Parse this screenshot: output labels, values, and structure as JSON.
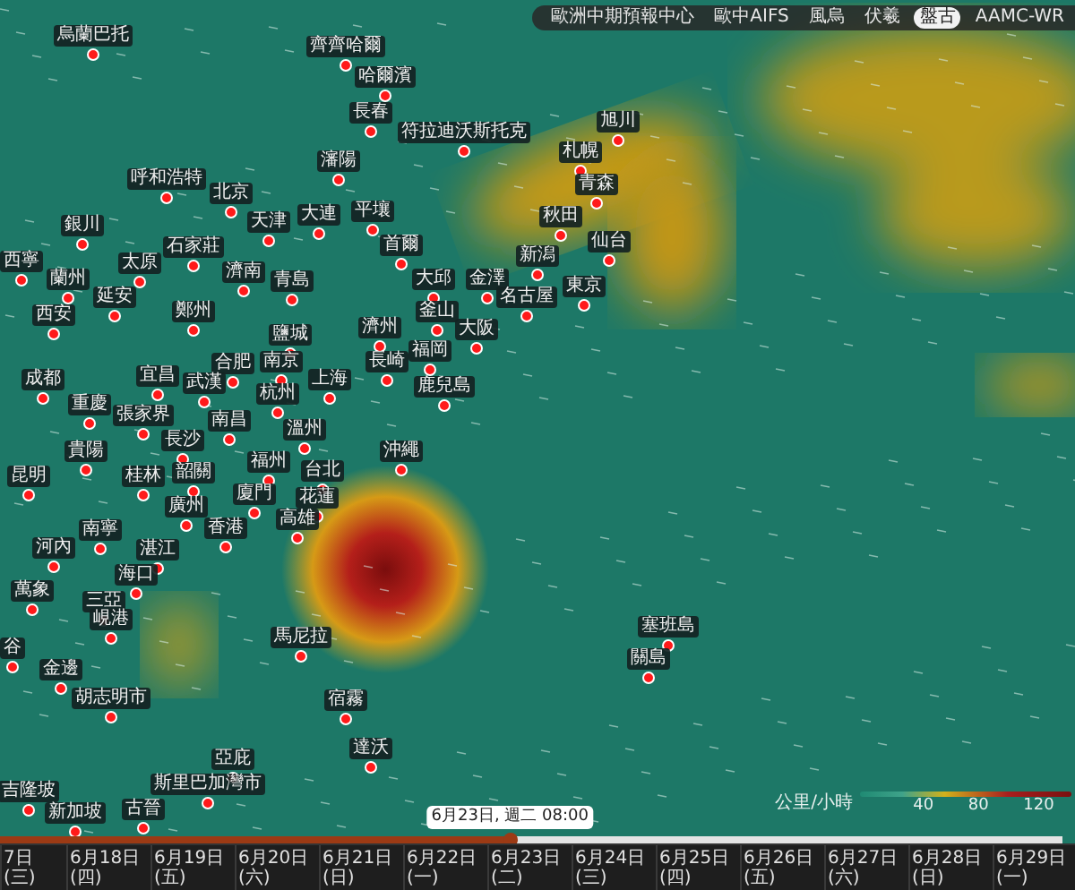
{
  "model_bar": {
    "models": [
      {
        "label": "歐洲中期預報中心",
        "selected": false
      },
      {
        "label": "歐中AIFS",
        "selected": false
      },
      {
        "label": "風烏",
        "selected": false
      },
      {
        "label": "伏羲",
        "selected": false
      },
      {
        "label": "盤古",
        "selected": true
      },
      {
        "label": "AAMC-WR",
        "selected": false
      }
    ]
  },
  "cities": [
    "烏蘭巴托",
    "齊齊哈爾",
    "哈爾濱",
    "長春",
    "符拉迪沃斯托克",
    "瀋陽",
    "呼和浩特",
    "北京",
    "天津",
    "大連",
    "平壤",
    "首爾",
    "銀川",
    "石家莊",
    "西寧",
    "太原",
    "蘭州",
    "延安",
    "濟南",
    "青島",
    "大邱",
    "釜山",
    "旭川",
    "札幌",
    "青森",
    "秋田",
    "仙台",
    "新潟",
    "金澤",
    "東京",
    "名古屋",
    "大阪",
    "西安",
    "鄭州",
    "濟州",
    "福岡",
    "長崎",
    "鹿兒島",
    "鹽城",
    "合肥",
    "南京",
    "上海",
    "杭州",
    "成都",
    "宜昌",
    "武漢",
    "重慶",
    "張家界",
    "南昌",
    "長沙",
    "溫州",
    "貴陽",
    "沖繩",
    "昆明",
    "桂林",
    "韶關",
    "福州",
    "台北",
    "廈門",
    "花蓮",
    "廣州",
    "香港",
    "高雄",
    "南寧",
    "河內",
    "湛江",
    "海口",
    "三亞",
    "萬象",
    "峴港",
    "馬尼拉",
    "宿霧",
    "達沃",
    "谷",
    "金邊",
    "胡志明市",
    "亞庇",
    "斯里巴加灣市",
    "吉隆坡",
    "新加坡",
    "古晉",
    "塞班島",
    "關島"
  ],
  "legend": {
    "unit": "公里/小時",
    "ticks": [
      "40",
      "80",
      "120"
    ]
  },
  "timeline": {
    "tooltip": "6月23日, 週二 08:00",
    "level": 0.48,
    "dates": [
      "7日 (三)",
      "6月18日 (四)",
      "6月19日 (五)",
      "6月20日 (六)",
      "6月21日 (日)",
      "6月22日 (一)",
      "6月23日 (二)",
      "6月24日 (三)",
      "6月25日 (四)",
      "6月26日 (五)",
      "6月27日 (六)",
      "6月28日 (日)",
      "6月29日 (一)"
    ]
  }
}
